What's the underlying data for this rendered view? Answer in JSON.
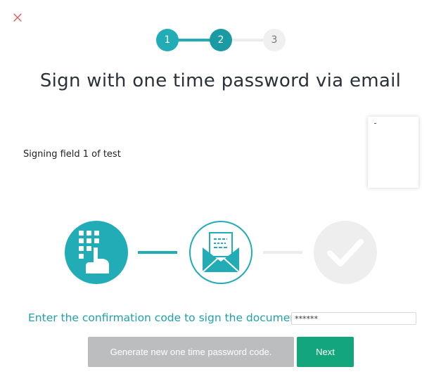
{
  "colors": {
    "accent": "#21acb6",
    "accent_dark": "#1a9aa3",
    "inactive": "#f0f0f0",
    "next_button": "#13a57b",
    "generate_button": "#bcbdbf",
    "close_icon": "#e06060"
  },
  "stepper": {
    "steps": [
      {
        "label": "1",
        "state": "completed"
      },
      {
        "label": "2",
        "state": "current"
      },
      {
        "label": "3",
        "state": "pending"
      }
    ]
  },
  "title": "Sign with one time password via email",
  "signing_field": "Signing field 1 of test",
  "process": {
    "stages": [
      {
        "icon": "keypad-hand-icon",
        "state": "done"
      },
      {
        "icon": "envelope-letter-icon",
        "state": "current"
      },
      {
        "icon": "checkmark-icon",
        "state": "pending"
      }
    ]
  },
  "confirmation": {
    "label": "Enter the confirmation code to sign the document.",
    "value": "******"
  },
  "buttons": {
    "generate_label": "Generate new one time password code.",
    "next_label": "Next"
  }
}
